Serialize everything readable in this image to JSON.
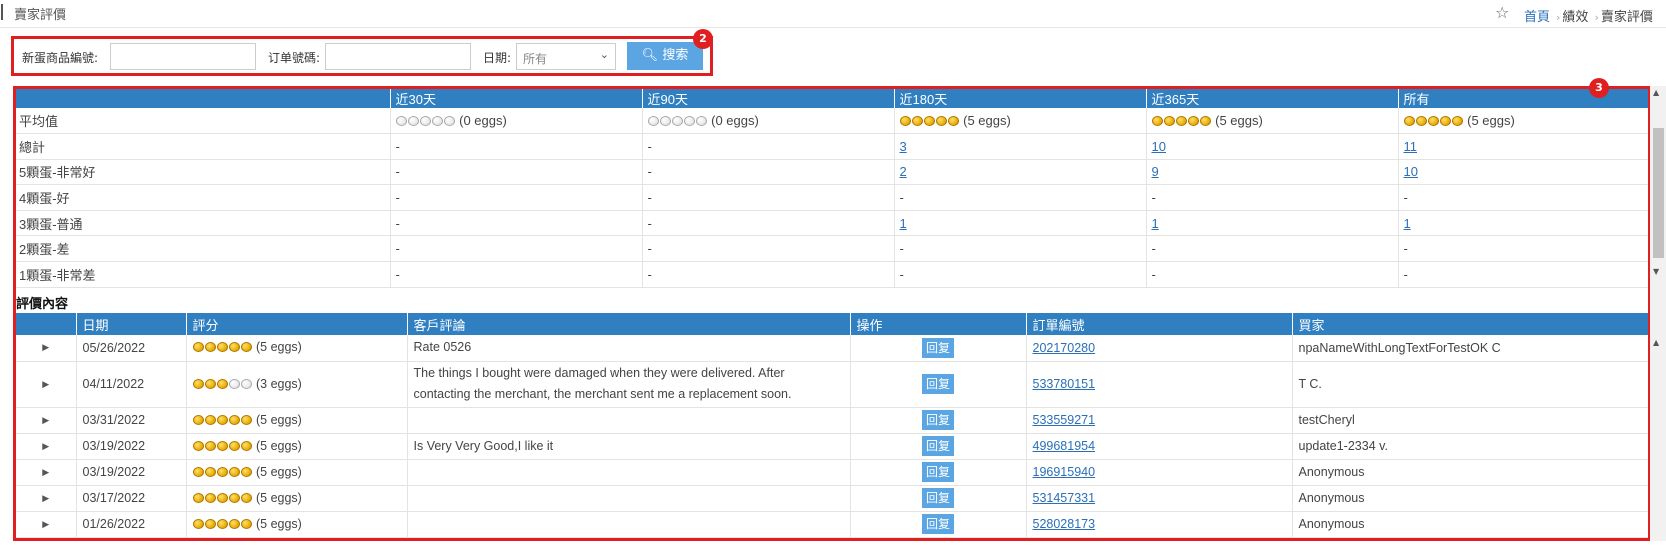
{
  "header": {
    "title": "賣家評價",
    "breadcrumb": {
      "home": "首頁",
      "level2": "績效",
      "current": "賣家評價"
    }
  },
  "search": {
    "item_label": "新蛋商品編號:",
    "item_value": "",
    "order_label": "订单號碼:",
    "order_value": "",
    "date_label": "日期:",
    "date_selected": "所有",
    "search_button": "搜索",
    "badge": "2"
  },
  "results_badge": "3",
  "stats": {
    "columns": [
      "",
      "近30天",
      "近90天",
      "近180天",
      "近365天",
      "所有"
    ],
    "average": {
      "label": "平均值",
      "cells": [
        {
          "eggs": 0,
          "text": "(0 eggs)"
        },
        {
          "eggs": 0,
          "text": "(0 eggs)"
        },
        {
          "eggs": 5,
          "text": "(5 eggs)"
        },
        {
          "eggs": 5,
          "text": "(5 eggs)"
        },
        {
          "eggs": 5,
          "text": "(5 eggs)"
        }
      ]
    },
    "rows": [
      {
        "label": "總計",
        "values": [
          "-",
          "-",
          "3",
          "10",
          "11"
        ]
      },
      {
        "label": "5顆蛋-非常好",
        "values": [
          "-",
          "-",
          "2",
          "9",
          "10"
        ]
      },
      {
        "label": "4顆蛋-好",
        "values": [
          "-",
          "-",
          "-",
          "-",
          "-"
        ]
      },
      {
        "label": "3顆蛋-普通",
        "values": [
          "-",
          "-",
          "1",
          "1",
          "1"
        ]
      },
      {
        "label": "2顆蛋-差",
        "values": [
          "-",
          "-",
          "-",
          "-",
          "-"
        ]
      },
      {
        "label": "1顆蛋-非常差",
        "values": [
          "-",
          "-",
          "-",
          "-",
          "-"
        ]
      }
    ]
  },
  "reviews": {
    "section_title": "評價內容",
    "columns": [
      "",
      "日期",
      "評分",
      "客戶評論",
      "操作",
      "訂單編號",
      "買家"
    ],
    "reply_label": "回复",
    "rows": [
      {
        "date": "05/26/2022",
        "eggs": 5,
        "rating_text": "(5 eggs)",
        "comment": "Rate 0526",
        "order": "202170280",
        "buyer": "npaNameWithLongTextForTestOK C"
      },
      {
        "date": "04/11/2022",
        "eggs": 3,
        "rating_text": "(3 eggs)",
        "comment": "The things I bought were damaged when they were delivered. After contacting the merchant, the merchant sent me a replacement soon.",
        "order": "533780151",
        "buyer": "T C."
      },
      {
        "date": "03/31/2022",
        "eggs": 5,
        "rating_text": "(5 eggs)",
        "comment": "",
        "order": "533559271",
        "buyer": "testCheryl"
      },
      {
        "date": "03/19/2022",
        "eggs": 5,
        "rating_text": "(5 eggs)",
        "comment": "Is Very Very Good,I like it",
        "order": "499681954",
        "buyer": "update1-2334 v."
      },
      {
        "date": "03/19/2022",
        "eggs": 5,
        "rating_text": "(5 eggs)",
        "comment": "",
        "order": "196915940",
        "buyer": "Anonymous"
      },
      {
        "date": "03/17/2022",
        "eggs": 5,
        "rating_text": "(5 eggs)",
        "comment": "",
        "order": "531457331",
        "buyer": "Anonymous"
      },
      {
        "date": "01/26/2022",
        "eggs": 5,
        "rating_text": "(5 eggs)",
        "comment": "",
        "order": "528028173",
        "buyer": "Anonymous"
      }
    ]
  },
  "colors": {
    "accent": "#2f7fc1",
    "button": "#5aa5e2",
    "highlight": "#e02020",
    "link": "#2a6fb8"
  }
}
